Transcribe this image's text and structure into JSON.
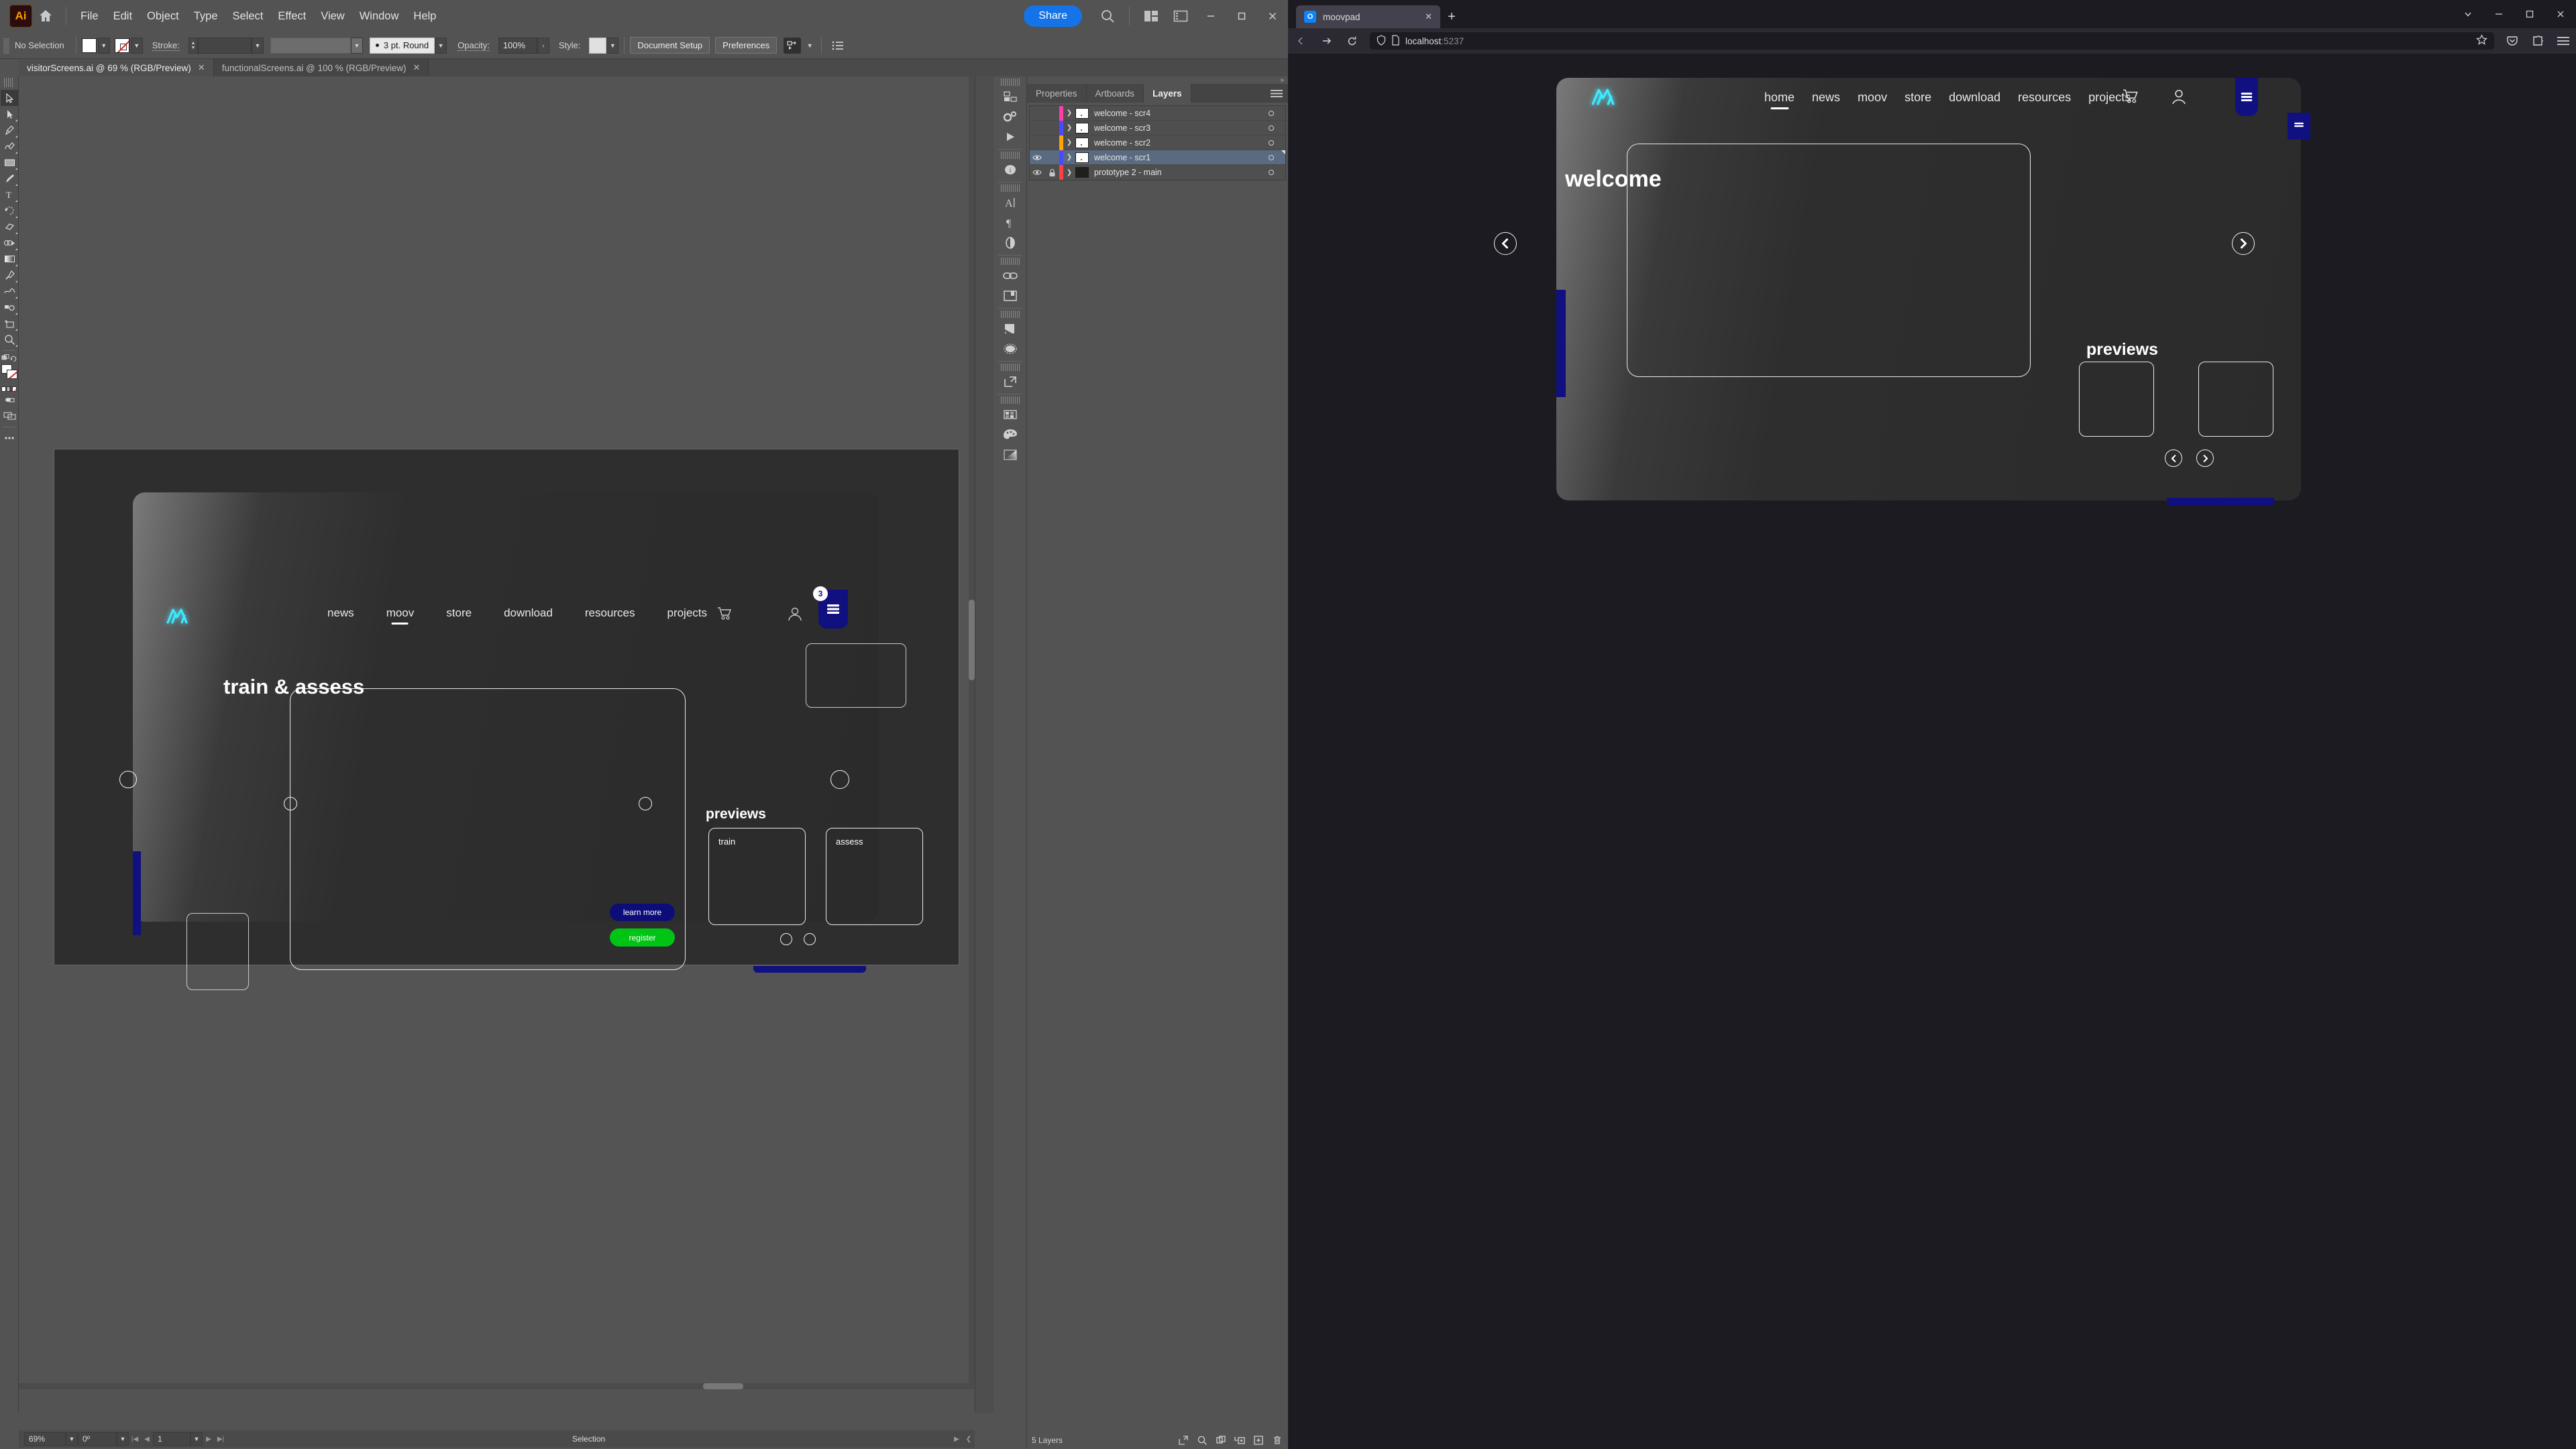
{
  "illustrator": {
    "app_name": "Ai",
    "menus": [
      "File",
      "Edit",
      "Object",
      "Type",
      "Select",
      "Effect",
      "View",
      "Window",
      "Help"
    ],
    "toolbar_right": {
      "share_label": "Share",
      "icons": [
        "search-icon",
        "arrange-documents-icon",
        "workspace-switcher-icon"
      ]
    },
    "window_controls": [
      "minimize",
      "maximize",
      "close"
    ],
    "control_bar": {
      "selection_state": "No Selection",
      "fill_swatch": "white",
      "stroke_swatch": "none",
      "stroke_label": "Stroke:",
      "stroke_weight": "",
      "stroke_profile": "3 pt. Round",
      "opacity_label": "Opacity:",
      "opacity_value": "100%",
      "style_label": "Style:",
      "document_setup_label": "Document Setup",
      "preferences_label": "Preferences"
    },
    "document_tabs": [
      {
        "title": "visitorScreens.ai @ 69 % (RGB/Preview)",
        "active": true
      },
      {
        "title": "functionalScreens.ai @ 100 % (RGB/Preview)",
        "active": false
      }
    ],
    "tools": [
      "selection-tool",
      "direct-selection-tool",
      "pen-tool",
      "curvature-tool",
      "rectangle-tool",
      "paintbrush-tool",
      "type-tool",
      "rotate-tool",
      "eraser-tool",
      "shape-builder-tool",
      "gradient-tool",
      "eyedropper-tool",
      "blend-tool",
      "symbol-sprayer-tool",
      "artboard-tool",
      "zoom-tool"
    ],
    "status_bar": {
      "zoom": "69%",
      "rotation": "0º",
      "artboard_number": "1",
      "status_text": "Selection"
    },
    "panel_rail_icons": [
      "libraries-icon",
      "properties-gear-icon",
      "actions-play-icon",
      "info-icon",
      "character-icon",
      "paragraph-icon",
      "transparency-icon",
      "links-icon",
      "asset-export-icon",
      "symbols-icon",
      "appearance-icon",
      "artboards-icon",
      "swatches-icon",
      "color-icon",
      "gradient-icon"
    ],
    "panel": {
      "tabs": [
        {
          "label": "Properties",
          "active": false
        },
        {
          "label": "Artboards",
          "active": false
        },
        {
          "label": "Layers",
          "active": true
        }
      ],
      "menu_icon": "panel-menu-icon",
      "layers": [
        {
          "name": "welcome - scr4",
          "color": "#ff3ea5",
          "visible": false,
          "locked": false,
          "selected": false,
          "thumb": "light"
        },
        {
          "name": "welcome - scr3",
          "color": "#4a4aff",
          "visible": false,
          "locked": false,
          "selected": false,
          "thumb": "light"
        },
        {
          "name": "welcome - scr2",
          "color": "#ffa500",
          "visible": false,
          "locked": false,
          "selected": false,
          "thumb": "light"
        },
        {
          "name": "welcome - scr1",
          "color": "#4a4aff",
          "visible": true,
          "locked": false,
          "selected": true,
          "thumb": "light"
        },
        {
          "name": "prototype 2 - main",
          "color": "#ff4040",
          "visible": true,
          "locked": true,
          "selected": false,
          "thumb": "dark"
        }
      ],
      "footer": {
        "count_label": "5 Layers",
        "icons": [
          "release-to-layers-icon",
          "locate-object-icon",
          "collect-in-new-layer-icon",
          "make-sublayer-icon",
          "new-layer-icon",
          "delete-layer-icon"
        ]
      }
    }
  },
  "artwork": {
    "brand_logo": "moov-logo-icon",
    "nav": [
      {
        "label": "news",
        "active": false
      },
      {
        "label": "moov",
        "active": true
      },
      {
        "label": "store",
        "active": false
      },
      {
        "label": "download",
        "active": false
      },
      {
        "label": "resources",
        "active": false
      },
      {
        "label": "projects",
        "active": false
      }
    ],
    "nav_icons": [
      "cart-icon",
      "account-icon",
      "hamburger-menu-icon"
    ],
    "menu_badge": "3",
    "hero_title": "train & assess",
    "buttons": [
      {
        "label": "learn more",
        "color": "#0d0d7a"
      },
      {
        "label": "register",
        "color": "#00c414"
      }
    ],
    "previews_title": "previews",
    "preview_cards": [
      {
        "label": "train"
      },
      {
        "label": "assess"
      }
    ]
  },
  "browser": {
    "tab": {
      "title": "moovpad",
      "favicon": "moovpad-favicon",
      "close_icon": "close-icon"
    },
    "new_tab_icon": "new-tab-icon",
    "window_controls": [
      "list-all-tabs-chevron",
      "minimize",
      "maximize",
      "close"
    ],
    "nav_icons": [
      "back-arrow-icon",
      "forward-arrow-icon",
      "reload-icon"
    ],
    "url": "localhost",
    "url_port": ":5237",
    "url_icons": [
      "shield-icon",
      "page-icon"
    ],
    "star_icon": "bookmark-star-icon",
    "toolbar_icons": [
      "pocket-icon",
      "extensions-icon",
      "app-menu-icon"
    ],
    "page": {
      "brand_logo": "moov-logo-icon",
      "nav": [
        {
          "label": "home",
          "active": true
        },
        {
          "label": "news",
          "active": false
        },
        {
          "label": "moov",
          "active": false
        },
        {
          "label": "store",
          "active": false
        },
        {
          "label": "download",
          "active": false
        },
        {
          "label": "resources",
          "active": false
        },
        {
          "label": "projects",
          "active": false
        }
      ],
      "nav_icons": [
        "cart-icon",
        "account-icon",
        "hamburger-menu-icon"
      ],
      "hero_title": "welcome",
      "previews_title": "previews",
      "carousel_arrows": [
        "prev-arrow-icon",
        "next-arrow-icon"
      ]
    }
  }
}
